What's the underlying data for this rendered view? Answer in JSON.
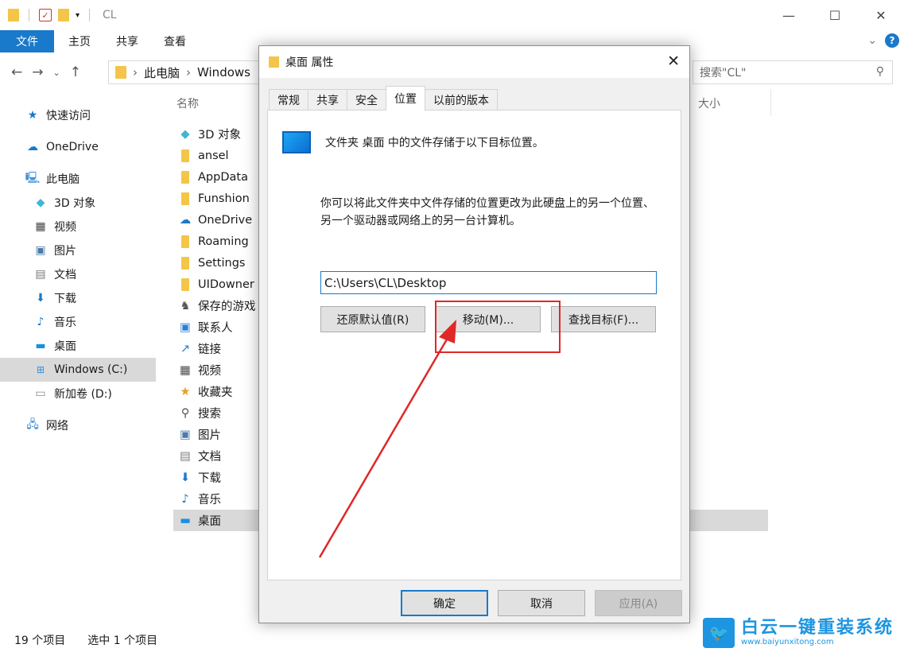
{
  "window": {
    "title": "CL",
    "controls": {
      "minimize": "—",
      "maximize": "☐",
      "close": "✕"
    }
  },
  "ribbon": {
    "tabs": [
      "文件",
      "主页",
      "共享",
      "查看"
    ]
  },
  "address": {
    "crumbs": [
      "此电脑",
      "Windows"
    ],
    "search_placeholder": "搜索\"CL\""
  },
  "navpane": {
    "quick_access": "快速访问",
    "onedrive": "OneDrive",
    "this_pc": "此电脑",
    "items": [
      "3D 对象",
      "视频",
      "图片",
      "文档",
      "下载",
      "音乐",
      "桌面",
      "Windows (C:)",
      "新加卷 (D:)"
    ],
    "network": "网络"
  },
  "filelist": {
    "col_name": "名称",
    "col_size": "大小",
    "items": [
      "3D 对象",
      "ansel",
      "AppData",
      "Funshion",
      "OneDrive",
      "Roaming",
      "Settings",
      "UIDowner",
      "保存的游戏",
      "联系人",
      "链接",
      "视频",
      "收藏夹",
      "搜索",
      "图片",
      "文档",
      "下载",
      "音乐",
      "桌面"
    ]
  },
  "status": {
    "count": "19 个项目",
    "selected": "选中 1 个项目"
  },
  "dialog": {
    "title": "桌面 属性",
    "tabs": [
      "常规",
      "共享",
      "安全",
      "位置",
      "以前的版本"
    ],
    "active_tab": "位置",
    "location_text": "文件夹 桌面 中的文件存储于以下目标位置。",
    "description": "你可以将此文件夹中文件存储的位置更改为此硬盘上的另一个位置、另一个驱动器或网络上的另一台计算机。",
    "path": "C:\\Users\\CL\\Desktop",
    "btn_restore": "还原默认值(R)",
    "btn_move": "移动(M)...",
    "btn_find": "查找目标(F)...",
    "btn_ok": "确定",
    "btn_cancel": "取消",
    "btn_apply": "应用(A)"
  },
  "watermark": {
    "name": "白云一键重装系统",
    "url": "www.baiyunxitong.com"
  },
  "colors": {
    "accent": "#1979ca",
    "highlight": "#e02828"
  }
}
